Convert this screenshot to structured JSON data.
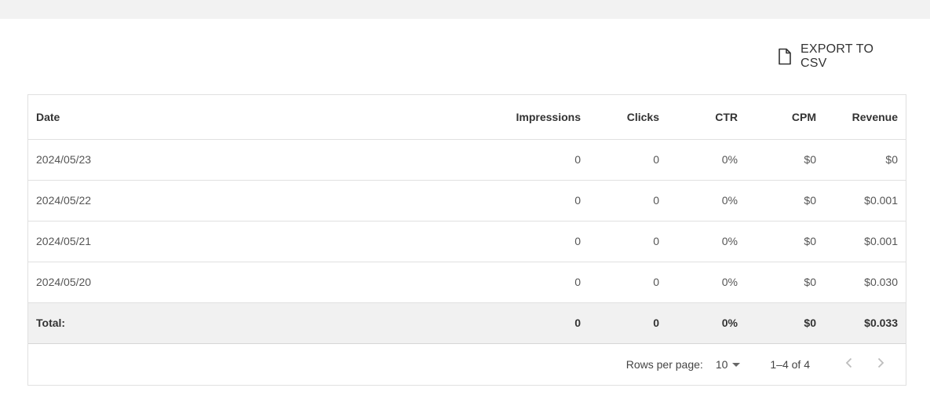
{
  "toolbar": {
    "export_label": "EXPORT TO CSV",
    "export_icon": "file-icon"
  },
  "table": {
    "columns": [
      "Date",
      "Impressions",
      "Clicks",
      "CTR",
      "CPM",
      "Revenue"
    ],
    "rows": [
      [
        "2024/05/23",
        "0",
        "0",
        "0%",
        "$0",
        "$0"
      ],
      [
        "2024/05/22",
        "0",
        "0",
        "0%",
        "$0",
        "$0.001"
      ],
      [
        "2024/05/21",
        "0",
        "0",
        "0%",
        "$0",
        "$0.001"
      ],
      [
        "2024/05/20",
        "0",
        "0",
        "0%",
        "$0",
        "$0.030"
      ]
    ],
    "total": [
      "Total:",
      "0",
      "0",
      "0%",
      "$0",
      "$0.033"
    ]
  },
  "pagination": {
    "rows_per_page_label": "Rows per page:",
    "rows_per_page_value": "10",
    "range": "1–4 of 4",
    "prev_icon": "chevron-left-icon",
    "next_icon": "chevron-right-icon"
  },
  "colors": {
    "header_strip": "#f2f2f2",
    "total_row_bg": "#f1f1f1",
    "border": "#e0e0e0",
    "nav_disabled": "#bdbdbd"
  }
}
